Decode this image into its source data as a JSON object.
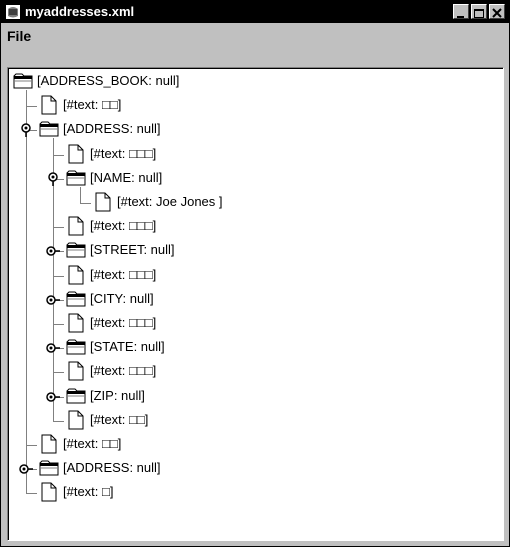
{
  "window": {
    "title": "myaddresses.xml"
  },
  "menu": {
    "file": "File"
  },
  "tree": {
    "n0": "[ADDRESS_BOOK: null]",
    "n1": "[#text: □□]",
    "n2": "[ADDRESS: null]",
    "n3": "[#text: □□□]",
    "n4": "[NAME: null]",
    "n5": "[#text: Joe Jones ]",
    "n6": "[#text: □□□]",
    "n7": "[STREET: null]",
    "n8": "[#text: □□□]",
    "n9": "[CITY: null]",
    "n10": "[#text: □□□]",
    "n11": "[STATE: null]",
    "n12": "[#text: □□□]",
    "n13": "[ZIP: null]",
    "n14": "[#text: □□]",
    "n15": "[#text: □□]",
    "n16": "[ADDRESS: null]",
    "n17": "[#text: □]"
  }
}
